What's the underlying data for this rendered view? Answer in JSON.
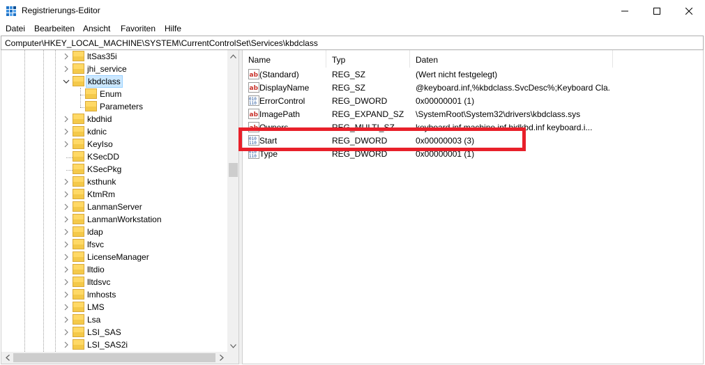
{
  "window": {
    "title": "Registrierungs-Editor",
    "minimize_icon": "minimize-icon",
    "maximize_icon": "maximize-icon",
    "close_icon": "close-icon"
  },
  "menu": [
    "Datei",
    "Bearbeiten",
    "Ansicht",
    "Favoriten",
    "Hilfe"
  ],
  "address": "Computer\\HKEY_LOCAL_MACHINE\\SYSTEM\\CurrentControlSet\\Services\\kbdclass",
  "tree": [
    {
      "label": "ltSas35i",
      "level": 0,
      "expandable": true,
      "expanded": false
    },
    {
      "label": "jhi_service",
      "level": 0,
      "expandable": true,
      "expanded": false
    },
    {
      "label": "kbdclass",
      "level": 0,
      "expandable": true,
      "expanded": true,
      "selected": true
    },
    {
      "label": "Enum",
      "level": 1,
      "expandable": false
    },
    {
      "label": "Parameters",
      "level": 1,
      "expandable": false
    },
    {
      "label": "kbdhid",
      "level": 0,
      "expandable": true,
      "expanded": false
    },
    {
      "label": "kdnic",
      "level": 0,
      "expandable": true,
      "expanded": false
    },
    {
      "label": "KeyIso",
      "level": 0,
      "expandable": true,
      "expanded": false
    },
    {
      "label": "KSecDD",
      "level": 0,
      "expandable": false
    },
    {
      "label": "KSecPkg",
      "level": 0,
      "expandable": false
    },
    {
      "label": "ksthunk",
      "level": 0,
      "expandable": true,
      "expanded": false
    },
    {
      "label": "KtmRm",
      "level": 0,
      "expandable": true,
      "expanded": false
    },
    {
      "label": "LanmanServer",
      "level": 0,
      "expandable": true,
      "expanded": false
    },
    {
      "label": "LanmanWorkstation",
      "level": 0,
      "expandable": true,
      "expanded": false
    },
    {
      "label": "ldap",
      "level": 0,
      "expandable": true,
      "expanded": false
    },
    {
      "label": "lfsvc",
      "level": 0,
      "expandable": true,
      "expanded": false
    },
    {
      "label": "LicenseManager",
      "level": 0,
      "expandable": true,
      "expanded": false
    },
    {
      "label": "lltdio",
      "level": 0,
      "expandable": true,
      "expanded": false
    },
    {
      "label": "lltdsvc",
      "level": 0,
      "expandable": true,
      "expanded": false
    },
    {
      "label": "lmhosts",
      "level": 0,
      "expandable": true,
      "expanded": false
    },
    {
      "label": "LMS",
      "level": 0,
      "expandable": true,
      "expanded": false
    },
    {
      "label": "Lsa",
      "level": 0,
      "expandable": true,
      "expanded": false
    },
    {
      "label": "LSI_SAS",
      "level": 0,
      "expandable": true,
      "expanded": false
    },
    {
      "label": "LSI_SAS2i",
      "level": 0,
      "expandable": true,
      "expanded": false
    }
  ],
  "columns": [
    "Name",
    "Typ",
    "Daten"
  ],
  "values": [
    {
      "name": "(Standard)",
      "type": "REG_SZ",
      "data": "(Wert nicht festgelegt)",
      "icon": "string-value-icon"
    },
    {
      "name": "DisplayName",
      "type": "REG_SZ",
      "data": "@keyboard.inf,%kbdclass.SvcDesc%;Keyboard Cla...",
      "icon": "string-value-icon"
    },
    {
      "name": "ErrorControl",
      "type": "REG_DWORD",
      "data": "0x00000001 (1)",
      "icon": "binary-value-icon"
    },
    {
      "name": "ImagePath",
      "type": "REG_EXPAND_SZ",
      "data": "\\SystemRoot\\System32\\drivers\\kbdclass.sys",
      "icon": "string-value-icon"
    },
    {
      "name": "Owners",
      "type": "REG_MULTI_SZ",
      "data": "keyboard.inf machine.inf hidkbd.inf keyboard.i...",
      "icon": "string-value-icon"
    },
    {
      "name": "Start",
      "type": "REG_DWORD",
      "data": "0x00000003 (3)",
      "icon": "binary-value-icon"
    },
    {
      "name": "Type",
      "type": "REG_DWORD",
      "data": "0x00000001 (1)",
      "icon": "binary-value-icon"
    }
  ],
  "colors": {
    "highlight_box": "#e8202a",
    "selection_bg": "#cce8ff",
    "folder": "#ffd966"
  }
}
